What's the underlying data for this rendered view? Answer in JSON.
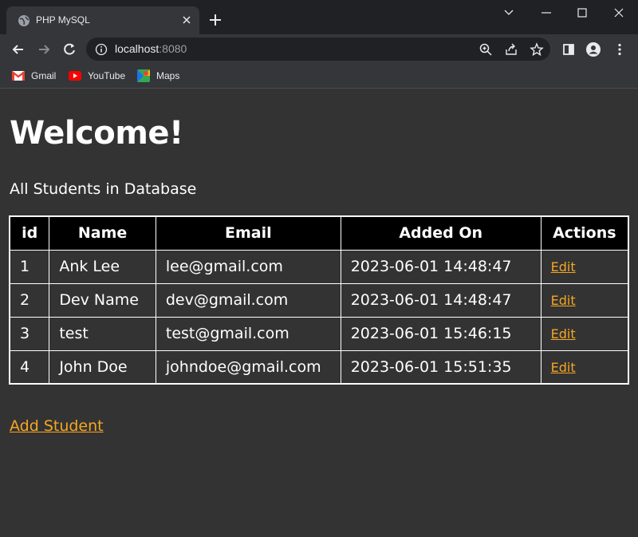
{
  "browser": {
    "tab_title": "PHP MySQL",
    "url_host": "localhost",
    "url_port": ":8080",
    "bookmarks": [
      {
        "label": "Gmail",
        "icon": "gmail-icon"
      },
      {
        "label": "YouTube",
        "icon": "youtube-icon"
      },
      {
        "label": "Maps",
        "icon": "maps-icon"
      }
    ]
  },
  "page": {
    "title": "Welcome!",
    "subtitle": "All Students in Database",
    "add_link": "Add Student",
    "table": {
      "headers": [
        "id",
        "Name",
        "Email",
        "Added On",
        "Actions"
      ],
      "rows": [
        {
          "id": "1",
          "name": "Ank Lee",
          "email": "lee@gmail.com",
          "added_on": "2023-06-01 14:48:47",
          "action": "Edit"
        },
        {
          "id": "2",
          "name": "Dev Name",
          "email": "dev@gmail.com",
          "added_on": "2023-06-01 14:48:47",
          "action": "Edit"
        },
        {
          "id": "3",
          "name": "test",
          "email": "test@gmail.com",
          "added_on": "2023-06-01 15:46:15",
          "action": "Edit"
        },
        {
          "id": "4",
          "name": "John Doe",
          "email": "johndoe@gmail.com",
          "added_on": "2023-06-01 15:51:35",
          "action": "Edit"
        }
      ]
    }
  },
  "colors": {
    "page_bg": "#333333",
    "header_bg": "#000000",
    "link": "#f5a623"
  }
}
